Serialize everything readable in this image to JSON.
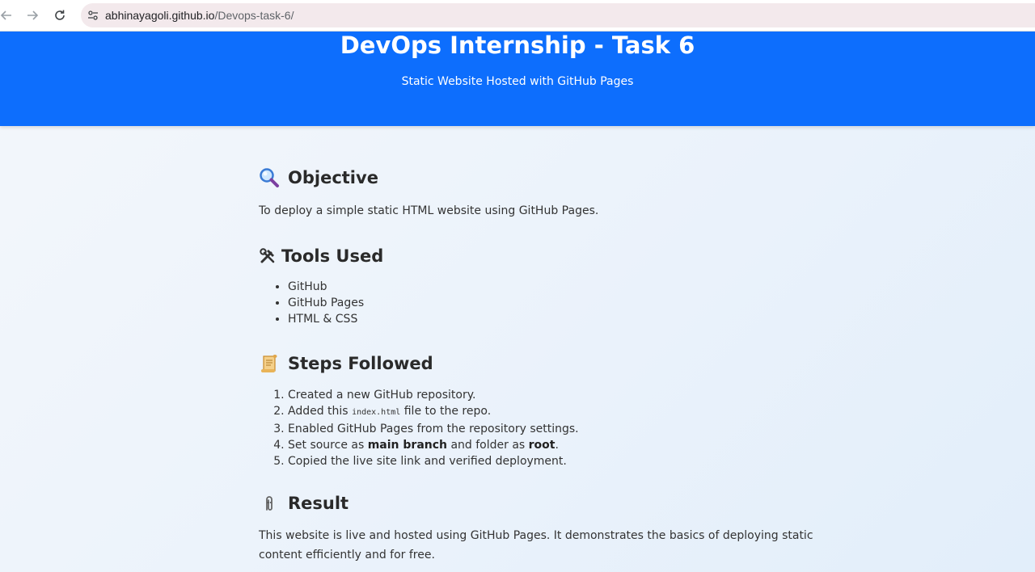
{
  "browser": {
    "url_host": "abhinayagoli.github.io",
    "url_path": "/Devops-task-6/",
    "back_icon": "arrow-left-icon",
    "forward_icon": "arrow-right-icon",
    "reload_icon": "reload-icon",
    "site_info_icon": "tune-icon"
  },
  "header": {
    "title": "DevOps Internship - Task 6",
    "subtitle": "Static Website Hosted with GitHub Pages",
    "bg_color": "#0d6efd"
  },
  "objective": {
    "icon": "magnifier-icon",
    "heading": "Objective",
    "text": "To deploy a simple static HTML website using GitHub Pages."
  },
  "tools": {
    "icon": "hammer-wrench-icon",
    "heading": "Tools Used",
    "items": [
      "GitHub",
      "GitHub Pages",
      "HTML & CSS"
    ]
  },
  "steps": {
    "icon": "scroll-icon",
    "heading": "Steps Followed",
    "s1": "Created a new GitHub repository.",
    "s2_pre": "Added this ",
    "s2_code": "index.html",
    "s2_post": " file to the repo.",
    "s3": "Enabled GitHub Pages from the repository settings.",
    "s4_pre": "Set source as ",
    "s4_bold1": "main branch",
    "s4_mid": " and folder as ",
    "s4_bold2": "root",
    "s4_post": ".",
    "s5": "Copied the live site link and verified deployment."
  },
  "result": {
    "icon": "paperclip-icon",
    "heading": "Result",
    "text": "This website is live and hosted using GitHub Pages. It demonstrates the basics of deploying static content efficiently and for free."
  }
}
